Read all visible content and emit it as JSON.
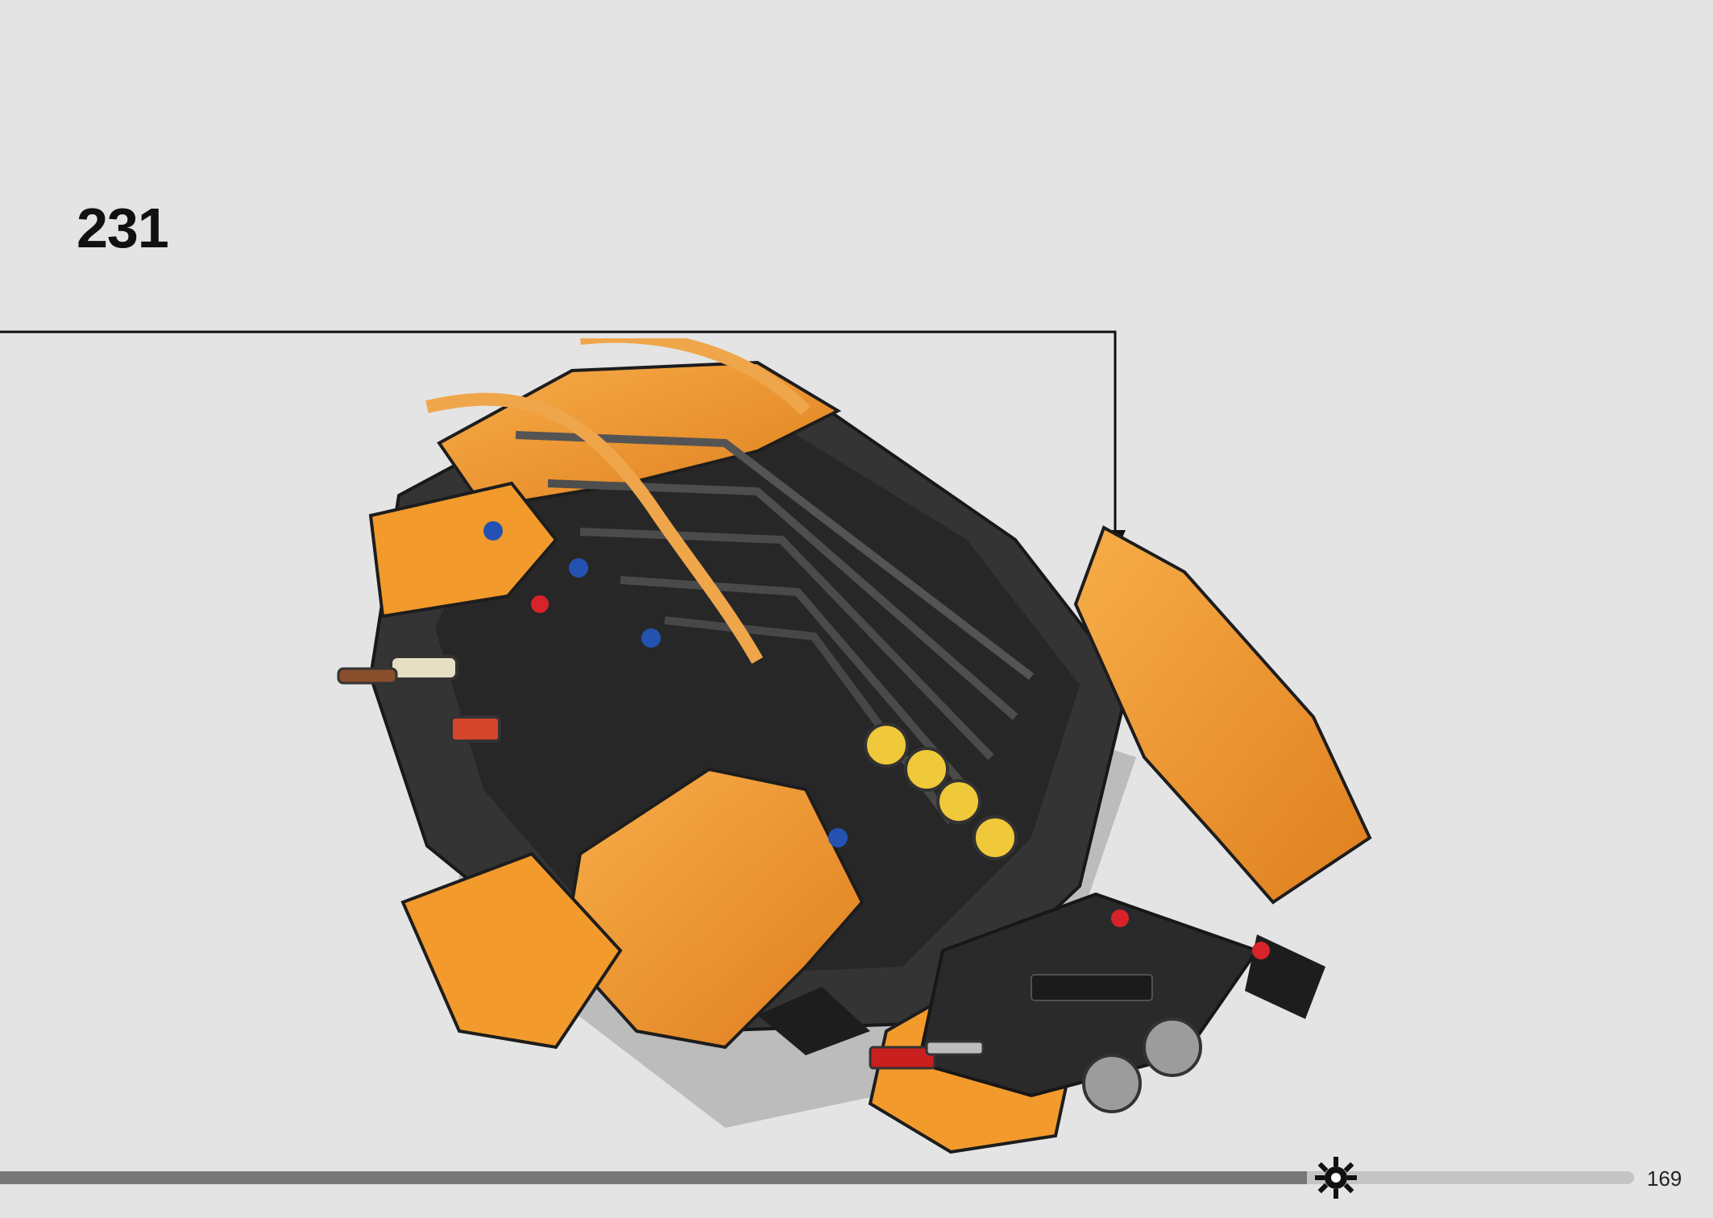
{
  "page": {
    "background_color": "#e4e4e4"
  },
  "step": {
    "number": "231"
  },
  "callout": {
    "line_color": "#000000",
    "arrow_icon": "arrow-down-icon"
  },
  "model": {
    "icon": "lego-technic-car-model-illustration",
    "primary_color": "#f39a2c",
    "secondary_color": "#333333",
    "highlight_color": "#d8232a",
    "highlight_circle_count": 2
  },
  "footer": {
    "progress": 0.8,
    "progress_icon": "gear-icon",
    "page_number": "169"
  }
}
